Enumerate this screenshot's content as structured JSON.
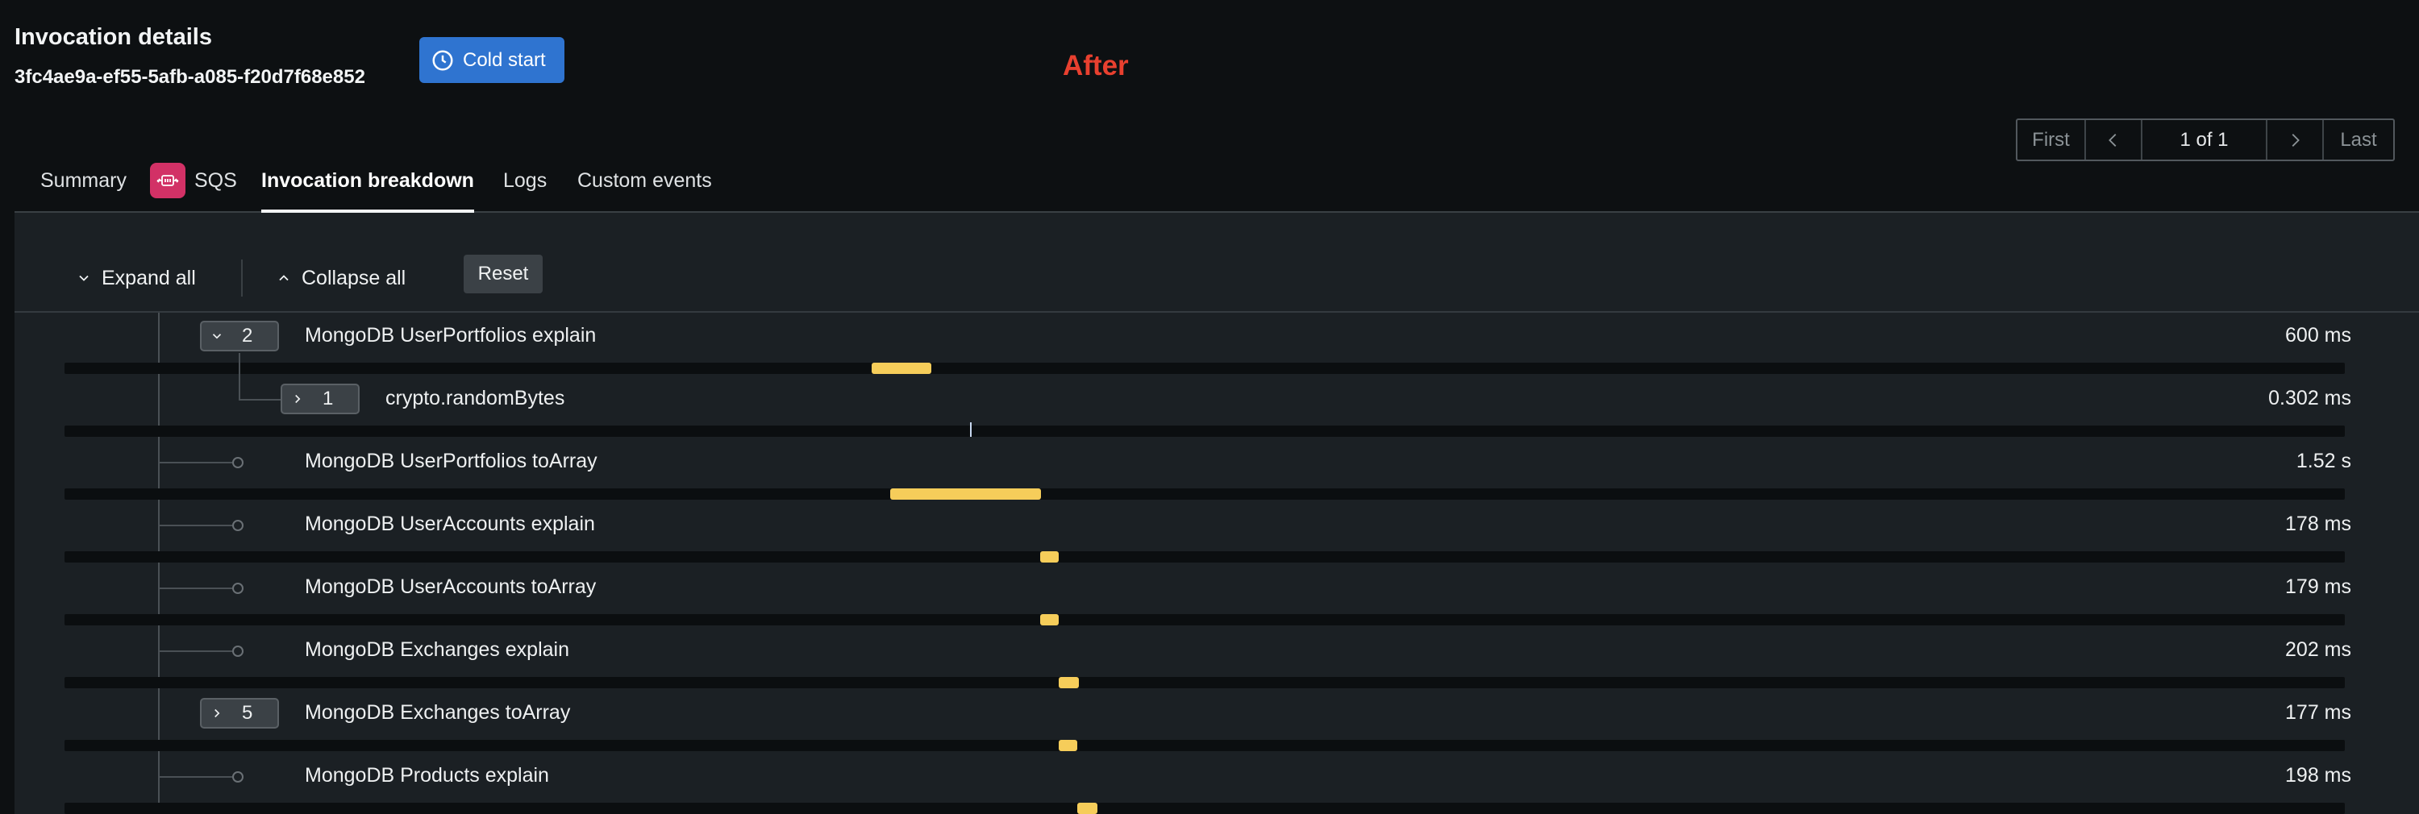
{
  "header": {
    "title": "Invocation details",
    "invocation_id": "3fc4ae9a-ef55-5afb-a085-f20d7f68e852",
    "badge_label": "Cold start",
    "badge_color": "#2f74d0",
    "annotation": "After",
    "annotation_color": "#e8402f"
  },
  "pager": {
    "first": "First",
    "status": "1 of 1",
    "last": "Last"
  },
  "tabs": [
    {
      "label": "Summary"
    },
    {
      "label": "SQS",
      "icon": "sqs-icon"
    },
    {
      "label": "Invocation breakdown",
      "active": true
    },
    {
      "label": "Logs"
    },
    {
      "label": "Custom events"
    }
  ],
  "toolbar": {
    "expand_all": "Expand all",
    "collapse_all": "Collapse all",
    "reset": "Reset"
  },
  "spans": [
    {
      "name": "MongoDB UserPortfolios explain",
      "duration": "600 ms",
      "children_count": "2",
      "expanded": true,
      "bar_start": 0.354,
      "bar_length": 0.026
    },
    {
      "name": "crypto.randomBytes",
      "duration": "0.302 ms",
      "children_count": "1",
      "expanded": false,
      "bar_start": 0.397,
      "bar_length": 0.0
    },
    {
      "name": "MongoDB UserPortfolios toArray",
      "duration": "1.52 s",
      "bar_start": 0.362,
      "bar_length": 0.066
    },
    {
      "name": "MongoDB UserAccounts explain",
      "duration": "178 ms",
      "bar_start": 0.428,
      "bar_length": 0.008
    },
    {
      "name": "MongoDB UserAccounts toArray",
      "duration": "179 ms",
      "bar_start": 0.428,
      "bar_length": 0.008
    },
    {
      "name": "MongoDB Exchanges explain",
      "duration": "202 ms",
      "bar_start": 0.436,
      "bar_length": 0.009
    },
    {
      "name": "MongoDB Exchanges toArray",
      "duration": "177 ms",
      "children_count": "5",
      "expanded": false,
      "bar_start": 0.436,
      "bar_length": 0.008
    },
    {
      "name": "MongoDB Products explain",
      "duration": "198 ms",
      "bar_start": 0.444,
      "bar_length": 0.009
    }
  ],
  "bar_color": "#f6cd5a"
}
